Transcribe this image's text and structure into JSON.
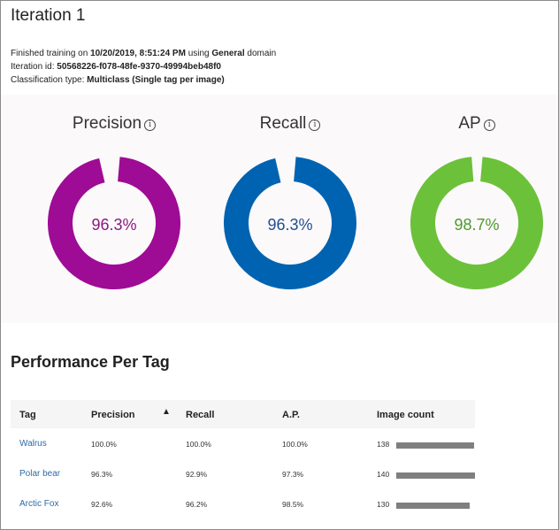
{
  "header": {
    "title": "Iteration 1",
    "trained_prefix": "Finished training on ",
    "trained_date": "10/20/2019, 8:51:24 PM",
    "trained_mid": " using ",
    "domain": "General",
    "trained_suffix": " domain",
    "iteration_label": "Iteration id: ",
    "iteration_id": "50568226-f078-48fe-9370-49994beb48f0",
    "classification_label": "Classification type: ",
    "classification_type": "Multiclass (Single tag per image)"
  },
  "metrics": [
    {
      "label": "Precision",
      "value_text": "96.3%",
      "fraction": 0.963,
      "color": "#9e0b95",
      "text_color": "#8a1a7f"
    },
    {
      "label": "Recall",
      "value_text": "96.3%",
      "fraction": 0.963,
      "color": "#0063b1",
      "text_color": "#214f8c"
    },
    {
      "label": "AP",
      "value_text": "98.7%",
      "fraction": 0.987,
      "color": "#6cc13a",
      "text_color": "#4e9a2e"
    }
  ],
  "info_icon_glyph": "i",
  "performance": {
    "title": "Performance Per Tag",
    "columns": {
      "tag": "Tag",
      "precision": "Precision",
      "recall": "Recall",
      "ap": "A.P.",
      "image_count": "Image count"
    },
    "sort_glyph": "▲",
    "bar_color": "#7f7f7f",
    "max_count": 140,
    "rows": [
      {
        "tag": "Walrus",
        "precision": "100.0%",
        "recall": "100.0%",
        "ap": "100.0%",
        "image_count": "138",
        "count": 138
      },
      {
        "tag": "Polar bear",
        "precision": "96.3%",
        "recall": "92.9%",
        "ap": "97.3%",
        "image_count": "140",
        "count": 140
      },
      {
        "tag": "Arctic Fox",
        "precision": "92.6%",
        "recall": "96.2%",
        "ap": "98.5%",
        "image_count": "130",
        "count": 130
      }
    ]
  }
}
